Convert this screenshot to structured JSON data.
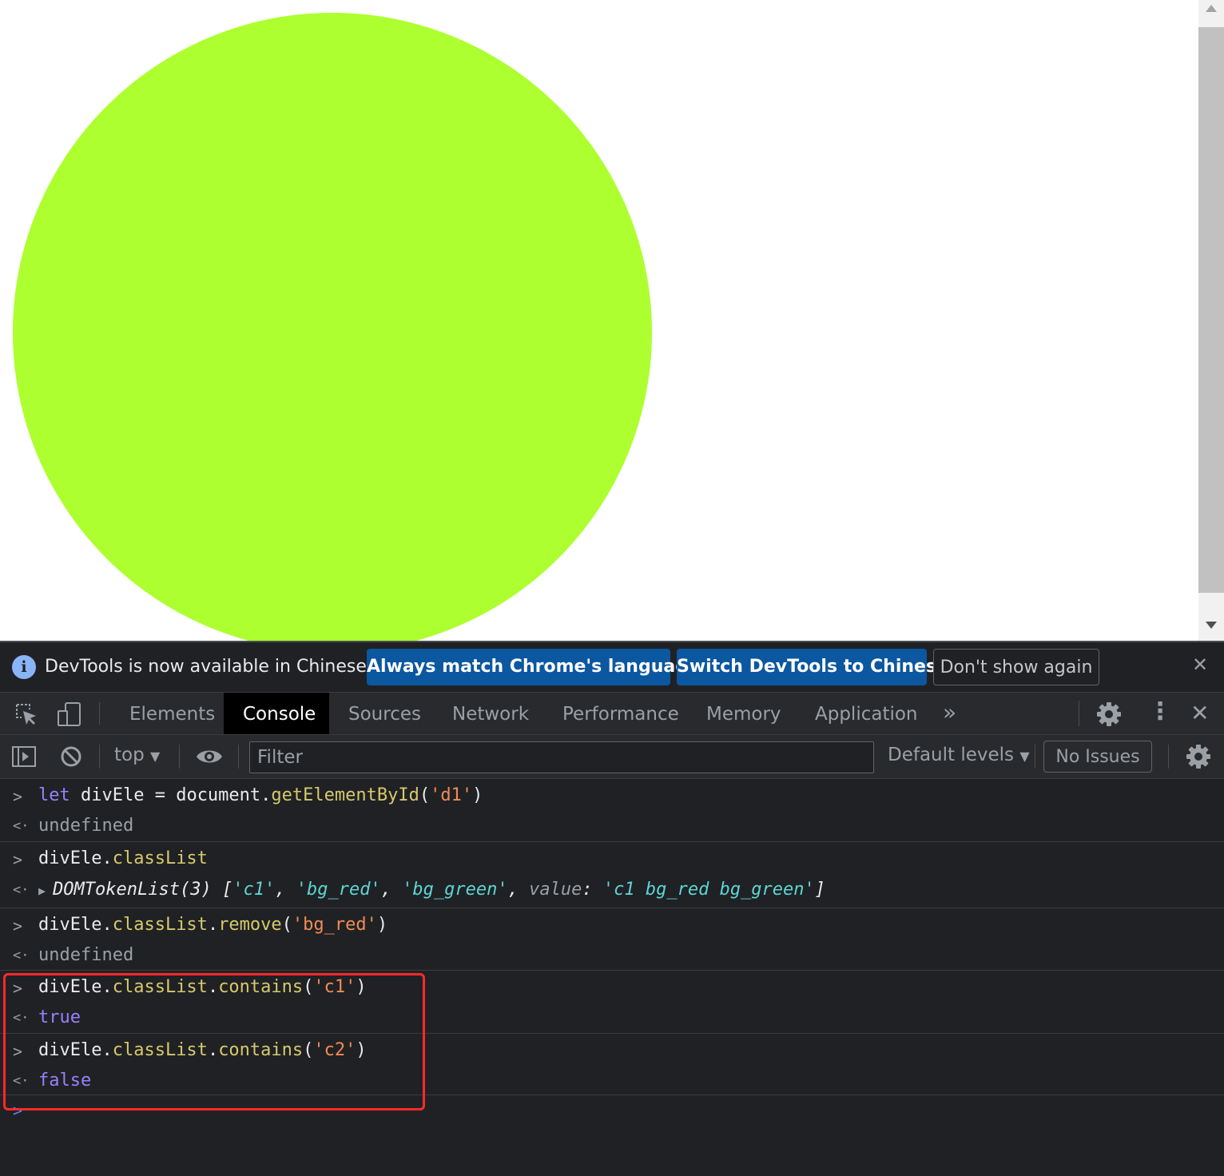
{
  "page": {
    "circle_color": "#adff2f"
  },
  "infobar": {
    "message": "DevTools is now available in Chinese!",
    "btn_match": "Always match Chrome's language",
    "btn_switch": "Switch DevTools to Chinese",
    "btn_dont": "Don't show again",
    "close": "✕"
  },
  "tabs": [
    "Elements",
    "Console",
    "Sources",
    "Network",
    "Performance",
    "Memory",
    "Application"
  ],
  "toolbar": {
    "more_tabs": "»",
    "kebab": "⋮",
    "close": "✕"
  },
  "console_bar": {
    "context": "top",
    "filter_placeholder": "Filter",
    "levels": "Default levels",
    "issues": "No Issues"
  },
  "log": {
    "e1": {
      "let": "let",
      "var": " divEle = document.",
      "method": "getElementById",
      "open": "(",
      "arg": "'d1'",
      "close": ")",
      "result": "undefined"
    },
    "e2": {
      "obj": "divEle.",
      "prop": "classList"
    },
    "e2r": {
      "head": "DOMTokenList(3) [",
      "s1": "'c1'",
      "c1": ", ",
      "s2": "'bg_red'",
      "c2": ", ",
      "s3": "'bg_green'",
      "c3": ", ",
      "key": "value",
      "colon": ": ",
      "s4": "'c1 bg_red bg_green'",
      "end": "]"
    },
    "e3": {
      "obj": "divEle.",
      "prop": "classList",
      "dot": ".",
      "method": "remove",
      "open": "(",
      "arg": "'bg_red'",
      "close": ")",
      "result": "undefined"
    },
    "e4": {
      "obj": "divEle.",
      "prop": "classList",
      "dot": ".",
      "method": "contains",
      "open": "(",
      "arg": "'c1'",
      "close": ")",
      "result": "true"
    },
    "e5": {
      "obj": "divEle.",
      "prop": "classList",
      "dot": ".",
      "method": "contains",
      "open": "(",
      "arg": "'c2'",
      "close": ")",
      "result": "false"
    }
  },
  "prompts": {
    "input": ">",
    "output": "<·"
  }
}
